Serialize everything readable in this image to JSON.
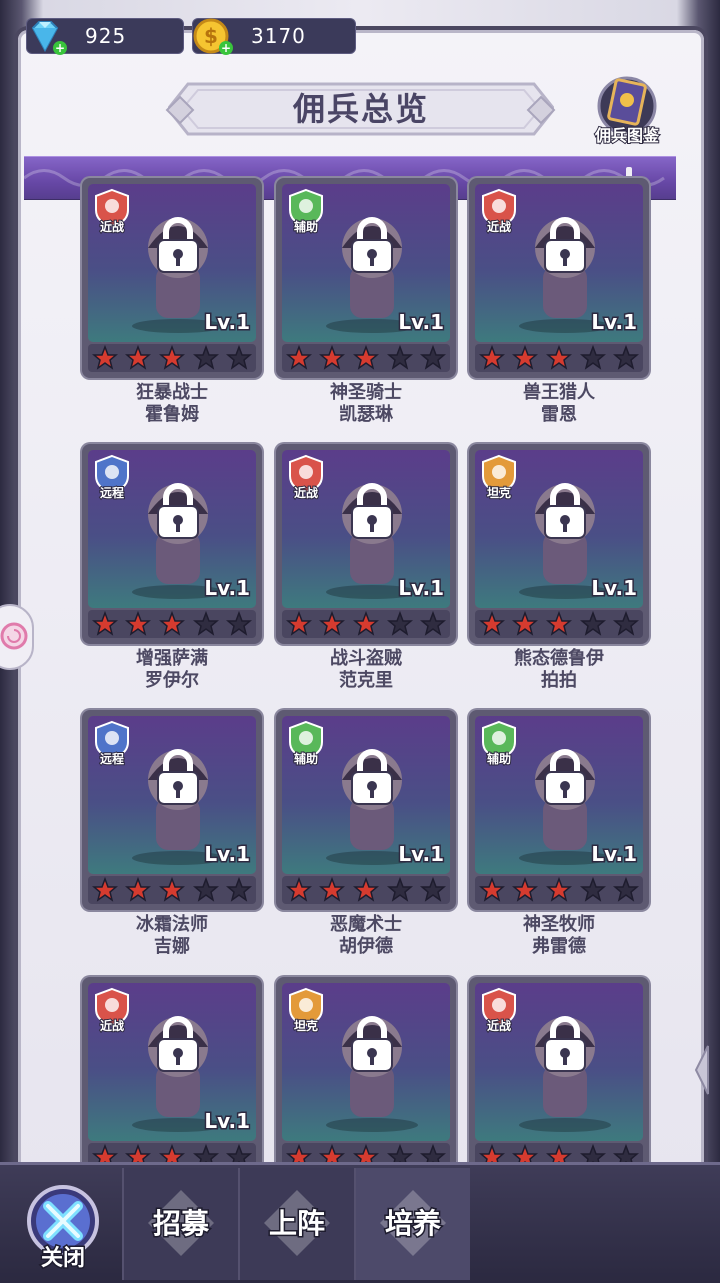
{
  "currency": {
    "gems": "925",
    "gold": "3170"
  },
  "header": {
    "title": "佣兵总览",
    "codex_label": "佣兵图鉴"
  },
  "heroes": [
    {
      "role": "近战",
      "role_type": "melee",
      "name": "狂暴战士",
      "sub": "霍鲁姆",
      "level": "Lv.1",
      "stars": 3,
      "max_stars": 5,
      "locked": true
    },
    {
      "role": "辅助",
      "role_type": "support",
      "name": "神圣骑士",
      "sub": "凯瑟琳",
      "level": "Lv.1",
      "stars": 3,
      "max_stars": 5,
      "locked": true
    },
    {
      "role": "近战",
      "role_type": "melee",
      "name": "兽王猎人",
      "sub": "雷恩",
      "level": "Lv.1",
      "stars": 3,
      "max_stars": 5,
      "locked": true
    },
    {
      "role": "远程",
      "role_type": "ranged",
      "name": "增强萨满",
      "sub": "罗伊尔",
      "level": "Lv.1",
      "stars": 3,
      "max_stars": 5,
      "locked": true
    },
    {
      "role": "近战",
      "role_type": "melee",
      "name": "战斗盗贼",
      "sub": "范克里",
      "level": "Lv.1",
      "stars": 3,
      "max_stars": 5,
      "locked": true
    },
    {
      "role": "坦克",
      "role_type": "tank",
      "name": "熊态德鲁伊",
      "sub": "拍拍",
      "level": "Lv.1",
      "stars": 3,
      "max_stars": 5,
      "locked": true
    },
    {
      "role": "远程",
      "role_type": "ranged",
      "name": "冰霜法师",
      "sub": "吉娜",
      "level": "Lv.1",
      "stars": 3,
      "max_stars": 5,
      "locked": true
    },
    {
      "role": "辅助",
      "role_type": "support",
      "name": "恶魔术士",
      "sub": "胡伊德",
      "level": "Lv.1",
      "stars": 3,
      "max_stars": 5,
      "locked": true
    },
    {
      "role": "辅助",
      "role_type": "support",
      "name": "神圣牧师",
      "sub": "弗雷德",
      "level": "Lv.1",
      "stars": 3,
      "max_stars": 5,
      "locked": true
    },
    {
      "role": "近战",
      "role_type": "melee",
      "name": "",
      "sub": "",
      "level": "Lv.1",
      "stars": 3,
      "max_stars": 5,
      "locked": true
    },
    {
      "role": "坦克",
      "role_type": "tank",
      "name": "",
      "sub": "",
      "level": "",
      "stars": 3,
      "max_stars": 5,
      "locked": true
    },
    {
      "role": "近战",
      "role_type": "melee",
      "name": "",
      "sub": "",
      "level": "",
      "stars": 3,
      "max_stars": 5,
      "locked": true
    }
  ],
  "role_colors": {
    "melee": "#d9534a",
    "support": "#59b85a",
    "ranged": "#4f74c9",
    "tank": "#e39a3a"
  },
  "star_colors": {
    "filled": "#d63b2f",
    "empty": "#2f2c40"
  },
  "bottom": {
    "close_label": "关闭",
    "tabs": [
      {
        "label": "招募",
        "active": false
      },
      {
        "label": "上阵",
        "active": false
      },
      {
        "label": "培养",
        "active": true
      }
    ]
  }
}
